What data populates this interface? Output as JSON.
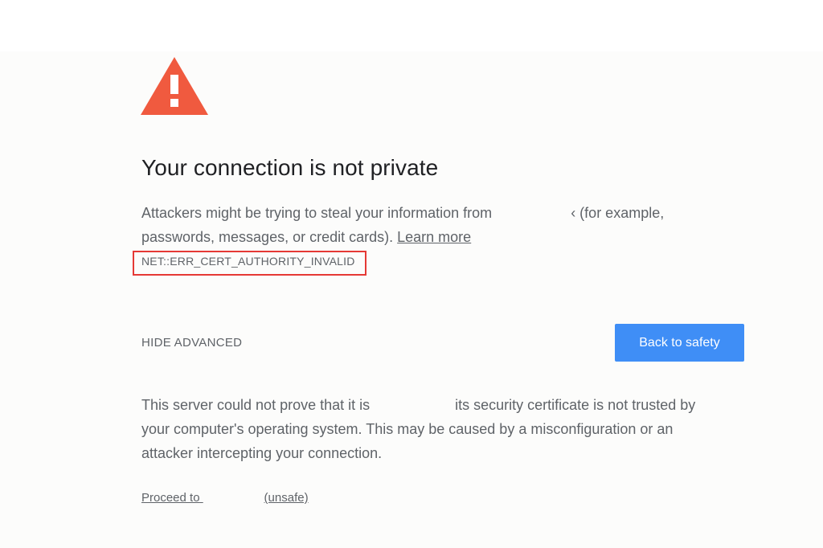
{
  "colors": {
    "warning_icon": "#f05a3f",
    "highlight_border": "#e53935",
    "primary_button": "#3f8ef6",
    "text": "#5f6368",
    "title": "#202124"
  },
  "icons": {
    "warning": "warning-triangle-icon"
  },
  "heading": "Your connection is not private",
  "intro": {
    "line1_prefix": "Attackers might be trying to steal your information from",
    "line1_suffix": "‹ (for example,",
    "line2_text": "passwords, messages, or credit cards).",
    "learn_more": "Learn more"
  },
  "error_code": "NET::ERR_CERT_AUTHORITY_INVALID",
  "hide_advanced": "HIDE ADVANCED",
  "back_to_safety": "Back to safety",
  "details": {
    "line1_prefix": "This server could not prove that it is",
    "line1_suffix": "its security certificate is not trusted by",
    "line2": "your computer's operating system. This may be caused by a misconfiguration or an",
    "line3": "attacker intercepting your connection."
  },
  "proceed": {
    "prefix": "Proceed to",
    "suffix": "(unsafe)"
  }
}
